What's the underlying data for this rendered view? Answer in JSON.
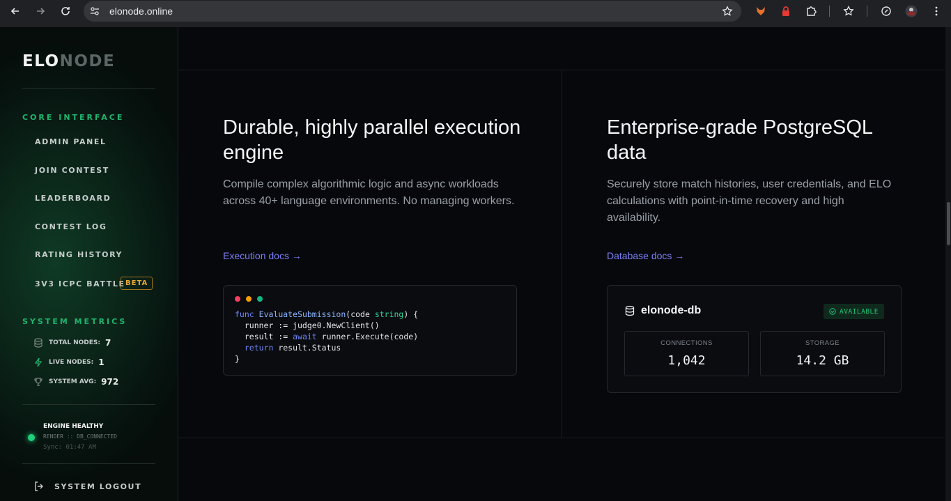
{
  "browser": {
    "url": "elonode.online"
  },
  "sidebar": {
    "logo_part1": "ELO",
    "logo_part2": "NODE",
    "core_title": "CORE INTERFACE",
    "items": [
      {
        "label": "ADMIN PANEL"
      },
      {
        "label": "JOIN CONTEST"
      },
      {
        "label": "LEADERBOARD"
      },
      {
        "label": "CONTEST LOG"
      },
      {
        "label": "RATING HISTORY"
      },
      {
        "label": "3V3 ICPC BATTLE",
        "badge": "BETA"
      }
    ],
    "metrics_title": "SYSTEM METRICS",
    "metrics": [
      {
        "label": "TOTAL NODES:",
        "value": "7",
        "icon": "database-icon"
      },
      {
        "label": "LIVE NODES:",
        "value": "1",
        "icon": "lightning-icon"
      },
      {
        "label": "SYSTEM AVG:",
        "value": "972",
        "icon": "trophy-icon"
      }
    ],
    "status": {
      "title": "ENGINE HEALTHY",
      "detail": "RENDER :: DB_CONNECTED",
      "sync": "Sync: 01:47 AM"
    },
    "logout": "SYSTEM LOGOUT"
  },
  "features": [
    {
      "title": "Durable, highly parallel execution engine",
      "description": "Compile complex algorithmic logic and async workloads across 40+ language environments. No managing workers.",
      "link": "Execution docs →"
    },
    {
      "title": "Enterprise-grade PostgreSQL data",
      "description": "Securely store match histories, user credentials, and ELO calculations with point-in-time recovery and high availability.",
      "link": "Database docs →"
    }
  ],
  "code": {
    "l1_kw": "func",
    "l1_fn": "EvaluateSubmission",
    "l1_a": "(code ",
    "l1_ty": "string",
    "l1_b": ") {",
    "l2": "  runner := judge0.NewClient()",
    "l3_a": "  result := ",
    "l3_kw": "await",
    "l3_b": " runner.Execute(code)",
    "l4_kw": "  return",
    "l4_b": " result.Status",
    "l5": "}"
  },
  "db": {
    "name": "elonode-db",
    "status": "AVAILABLE",
    "stats": [
      {
        "label": "CONNECTIONS",
        "value": "1,042"
      },
      {
        "label": "STORAGE",
        "value": "14.2 GB"
      }
    ]
  },
  "colors": {
    "accent_green": "#20b46e",
    "link_blue": "#7c7ff5",
    "beta_amber": "#e7a93a",
    "dot_red": "#f43f5e",
    "dot_amber": "#f59e0b",
    "dot_green": "#10b981"
  }
}
